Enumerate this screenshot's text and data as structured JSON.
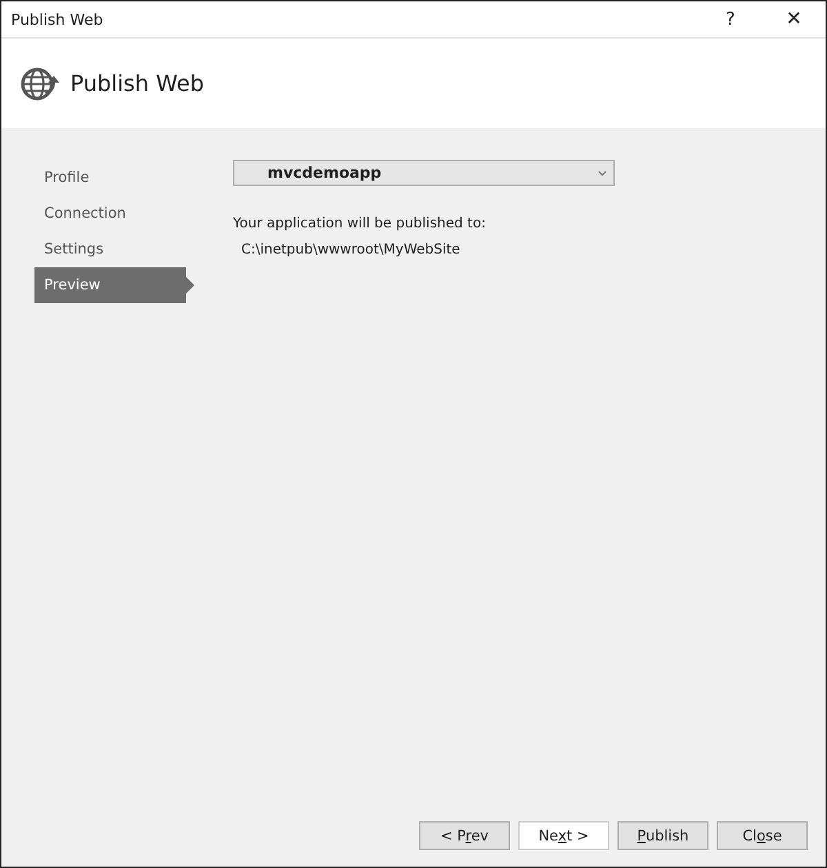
{
  "window": {
    "title": "Publish Web",
    "help": "?",
    "close": "✕"
  },
  "header": {
    "title": "Publish Web"
  },
  "sidebar": {
    "items": [
      {
        "label": "Profile",
        "selected": false
      },
      {
        "label": "Connection",
        "selected": false
      },
      {
        "label": "Settings",
        "selected": false
      },
      {
        "label": "Preview",
        "selected": true
      }
    ]
  },
  "profile_dropdown": {
    "value": "mvcdemoapp"
  },
  "publish_info": {
    "label": "Your application will be published to:",
    "path": "C:\\inetpub\\wwwroot\\MyWebSite"
  },
  "buttons": [
    {
      "before": "< P",
      "key": "r",
      "after": "ev",
      "disabled": false
    },
    {
      "before": "Ne",
      "key": "x",
      "after": "t >",
      "disabled": true
    },
    {
      "key": "P",
      "after": "ublish",
      "disabled": false
    },
    {
      "before": "Cl",
      "key": "o",
      "after": "se",
      "disabled": false
    }
  ]
}
